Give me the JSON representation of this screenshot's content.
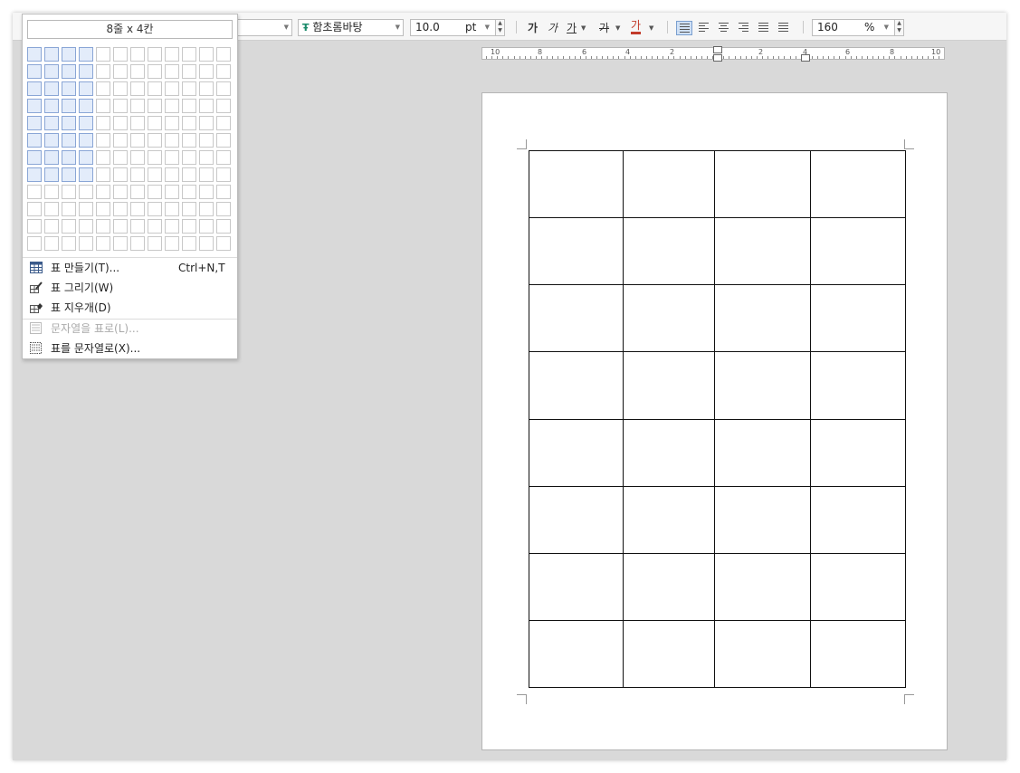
{
  "toolbar": {
    "font_name": "함초롬바탕",
    "font_size": "10.0",
    "font_unit": "pt",
    "bold": "가",
    "italic": "가",
    "underline": "가",
    "strike": "가",
    "font_color": "가",
    "zoom_value": "160",
    "zoom_unit": "%"
  },
  "ruler": {
    "numbers": [
      "10",
      "8",
      "6",
      "4",
      "2",
      "2",
      "4",
      "6",
      "8",
      "10"
    ]
  },
  "table_menu": {
    "size_label": "8줄 x 4칸",
    "selected_rows": 8,
    "selected_cols": 4,
    "grid_rows": 12,
    "grid_cols": 12,
    "items": [
      {
        "label": "표 만들기(T)...",
        "shortcut": "Ctrl+N,T",
        "icon": "table-grid-icon",
        "enabled": true
      },
      {
        "label": "표 그리기(W)",
        "shortcut": "",
        "icon": "pencil-table-icon",
        "enabled": true
      },
      {
        "label": "표 지우개(D)",
        "shortcut": "",
        "icon": "eraser-table-icon",
        "enabled": true
      },
      {
        "label": "문자열을 표로(L)...",
        "shortcut": "",
        "icon": "text-to-table-icon",
        "enabled": false
      },
      {
        "label": "표를 문자열로(X)...",
        "shortcut": "",
        "icon": "table-to-text-icon",
        "enabled": true
      }
    ]
  },
  "document": {
    "table_rows": 8,
    "table_cols": 4
  },
  "colors": {
    "selection_fill": "#e3ecfa",
    "selection_border": "#8aa6d6",
    "workspace": "#d9d9d9"
  }
}
